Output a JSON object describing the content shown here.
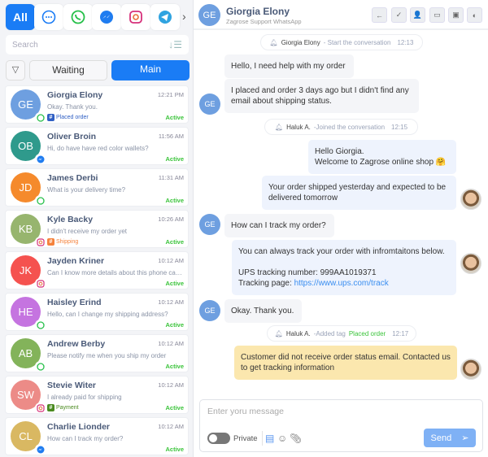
{
  "channels": [
    {
      "name": "All",
      "icon": "all"
    },
    {
      "name": "chat",
      "icon": "chat-bubble-icon"
    },
    {
      "name": "whatsapp",
      "icon": "whatsapp-icon"
    },
    {
      "name": "messenger",
      "icon": "messenger-icon"
    },
    {
      "name": "instagram",
      "icon": "instagram-icon"
    },
    {
      "name": "telegram",
      "icon": "telegram-icon"
    }
  ],
  "search": {
    "placeholder": "Search"
  },
  "tabs": {
    "waiting": "Waiting",
    "main": "Main"
  },
  "colors": {
    "accent": "#1a7cf5",
    "active": "#3bc43b",
    "note": "#fbe7ae"
  },
  "conversations": [
    {
      "initials": "GE",
      "name": "Giorgia Elony",
      "time": "12:21 PM",
      "preview": "Okay. Thank you.",
      "tag": "Placed order",
      "tag_color": "#2f5fc4",
      "status": "Active",
      "color": "#6e9fe0",
      "channel": "whatsapp"
    },
    {
      "initials": "OB",
      "name": "Oliver Broin",
      "time": "11:56 AM",
      "preview": "Hi, do have have red color wallets?",
      "status": "Active",
      "color": "#2f9a8c",
      "channel": "messenger"
    },
    {
      "initials": "JD",
      "name": "James Derbi",
      "time": "11:31 AM",
      "preview": "What is your delivery time?",
      "status": "Active",
      "color": "#f58a2c",
      "channel": "whatsapp"
    },
    {
      "initials": "KB",
      "name": "Kyle Backy",
      "time": "10:26 AM",
      "preview": "I didn't receive my order yet",
      "tag": "Shipping",
      "tag_color": "#f5823c",
      "status": "Active",
      "color": "#97b56e",
      "channel": "instagram"
    },
    {
      "initials": "JK",
      "name": "Jayden Kriner",
      "time": "10:12 AM",
      "preview": "Can I know more details about this phone case?",
      "status": "Active",
      "color": "#f5524f",
      "channel": "instagram"
    },
    {
      "initials": "HE",
      "name": "Haisley Erind",
      "time": "10:12 AM",
      "preview": "Hello, can I change my shipping address?",
      "status": "Active",
      "color": "#c574e0",
      "channel": "whatsapp"
    },
    {
      "initials": "AB",
      "name": "Andrew Berby",
      "time": "10:12 AM",
      "preview": "Please notify me when you ship my order",
      "status": "Active",
      "color": "#83b35a",
      "channel": "whatsapp"
    },
    {
      "initials": "SW",
      "name": "Stevie Witer",
      "time": "10:12 AM",
      "preview": "I already paid for shipping",
      "tag": "Payment",
      "tag_color": "#4a8a1f",
      "status": "Active",
      "color": "#ec8b87",
      "channel": "instagram"
    },
    {
      "initials": "CL",
      "name": "Charlie Lionder",
      "time": "10:12 AM",
      "preview": "How can I track my order?",
      "status": "Active",
      "color": "#d9b862",
      "channel": "messenger"
    }
  ],
  "header": {
    "initials": "GE",
    "name": "Giorgia Elony",
    "subtitle": "Zagrose Support WhatsApp",
    "actions": [
      "back-arrow-icon",
      "check-icon",
      "assign-user-icon",
      "tag-icon",
      "archive-icon",
      "contrast-icon"
    ]
  },
  "chat": {
    "sys1": {
      "who": "Giorgia Elony",
      "text": "- Start the conversation",
      "time": "12:13"
    },
    "m1": "Hello, I need help with my order",
    "m2": "I placed and order 3 days ago but I didn't find any email about shipping status.",
    "sys2": {
      "who": "Haluk A.",
      "text": "-Joined the conversation",
      "time": "12:15"
    },
    "m3a": "Hello Giorgia.",
    "m3b": "Welcome to Zagrose online shop 🤗",
    "m4": "Your order shipped yesterday and expected to be delivered tomorrow",
    "m5": "How can I track my order?",
    "m6a": "You can always track your order with infromtaitons below.",
    "m6b": "UPS tracking number: 999AA1019371",
    "m6c": "Tracking page: ",
    "m6link": "https://www.ups.com/track",
    "m7": "Okay. Thank you.",
    "sys3": {
      "who": "Haluk A.",
      "text": "-Added tag",
      "tag": "Placed order",
      "time": "12:17"
    },
    "m8": "Customer did not receive order status email. Contacted us to get tracking information",
    "avatar_initials": "GE"
  },
  "composer": {
    "placeholder": "Enter yoru message",
    "private_label": "Private",
    "private_on": false,
    "send_label": "Send"
  }
}
